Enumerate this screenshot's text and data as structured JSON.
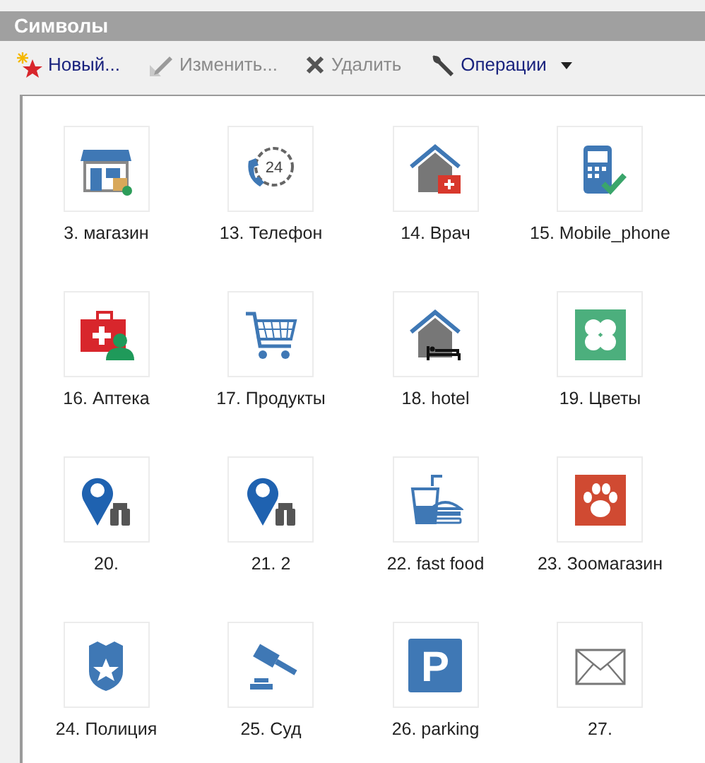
{
  "panel": {
    "title": "Символы"
  },
  "toolbar": [
    {
      "kind": "new",
      "label": "Новый...",
      "disabled": false
    },
    {
      "kind": "edit",
      "label": "Изменить...",
      "disabled": true
    },
    {
      "kind": "delete",
      "label": "Удалить",
      "disabled": true
    },
    {
      "kind": "operations",
      "label": "Операции",
      "disabled": false
    }
  ],
  "symbols": [
    {
      "kind": "store",
      "label": "3. магазин"
    },
    {
      "kind": "phone",
      "label": "13. Телефон",
      "glyph": "24"
    },
    {
      "kind": "doctor",
      "label": "14. Врач"
    },
    {
      "kind": "mobile",
      "label": "15. Mobile_phone"
    },
    {
      "kind": "firstaid",
      "label": "16. Аптека"
    },
    {
      "kind": "cart",
      "label": "17. Продукты"
    },
    {
      "kind": "hotel",
      "label": "18. hotel"
    },
    {
      "kind": "clover",
      "label": "19. Цветы"
    },
    {
      "kind": "pin",
      "label": "20."
    },
    {
      "kind": "pin",
      "label": "21. 2"
    },
    {
      "kind": "fastfood",
      "label": "22. fast food"
    },
    {
      "kind": "paw",
      "label": "23. Зоомагазин"
    },
    {
      "kind": "police",
      "label": "24. Полиция"
    },
    {
      "kind": "gavel",
      "label": "25. Суд"
    },
    {
      "kind": "parking",
      "label": "26. parking",
      "glyph": "P"
    },
    {
      "kind": "mail",
      "label": "27."
    }
  ]
}
